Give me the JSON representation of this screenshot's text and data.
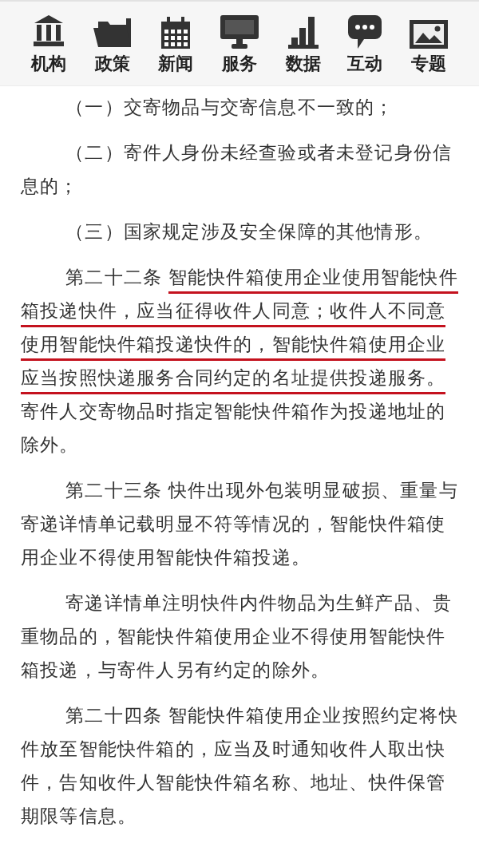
{
  "nav": [
    {
      "label": "机构",
      "kind": "bank"
    },
    {
      "label": "政策",
      "kind": "folder"
    },
    {
      "label": "新闻",
      "kind": "calendar"
    },
    {
      "label": "服务",
      "kind": "monitor"
    },
    {
      "label": "数据",
      "kind": "chart"
    },
    {
      "label": "互动",
      "kind": "chat"
    },
    {
      "label": "专题",
      "kind": "image"
    }
  ],
  "paragraphs": [
    [
      {
        "text": "（一）交寄物品与交寄信息不一致的；",
        "underlined": false
      }
    ],
    [
      {
        "text": "（二）寄件人身份未经查验或者未登记身份信息的；",
        "underlined": false
      }
    ],
    [
      {
        "text": "（三）国家规定涉及安全保障的其他情形。",
        "underlined": false
      }
    ],
    [
      {
        "text": "第二十二条 ",
        "underlined": false
      },
      {
        "text": "智能快件箱使用企业使用智能快件箱投递快件，应当征得收件人同意；收件人不同意使用智能快件箱投递快件的，智能快件箱使用企业应当按照快递服务合同约定的名址提供投递服务。",
        "underlined": true
      },
      {
        "text": "寄件人交寄物品时指定智能快件箱作为投递地址的除外。",
        "underlined": false
      }
    ],
    [
      {
        "text": "第二十三条 快件出现外包装明显破损、重量与寄递详情单记载明显不符等情况的，智能快件箱使用企业不得使用智能快件箱投递。",
        "underlined": false
      }
    ],
    [
      {
        "text": "寄递详情单注明快件内件物品为生鲜产品、贵重物品的，智能快件箱使用企业不得使用智能快件箱投递，与寄件人另有约定的除外。",
        "underlined": false
      }
    ],
    [
      {
        "text": "第二十四条 智能快件箱使用企业按照约定将快件放至智能快件箱的，应当及时通知收件人取出快件，告知收件人智能快件箱名称、地址、快件保管期限等信息。",
        "underlined": false
      }
    ]
  ]
}
